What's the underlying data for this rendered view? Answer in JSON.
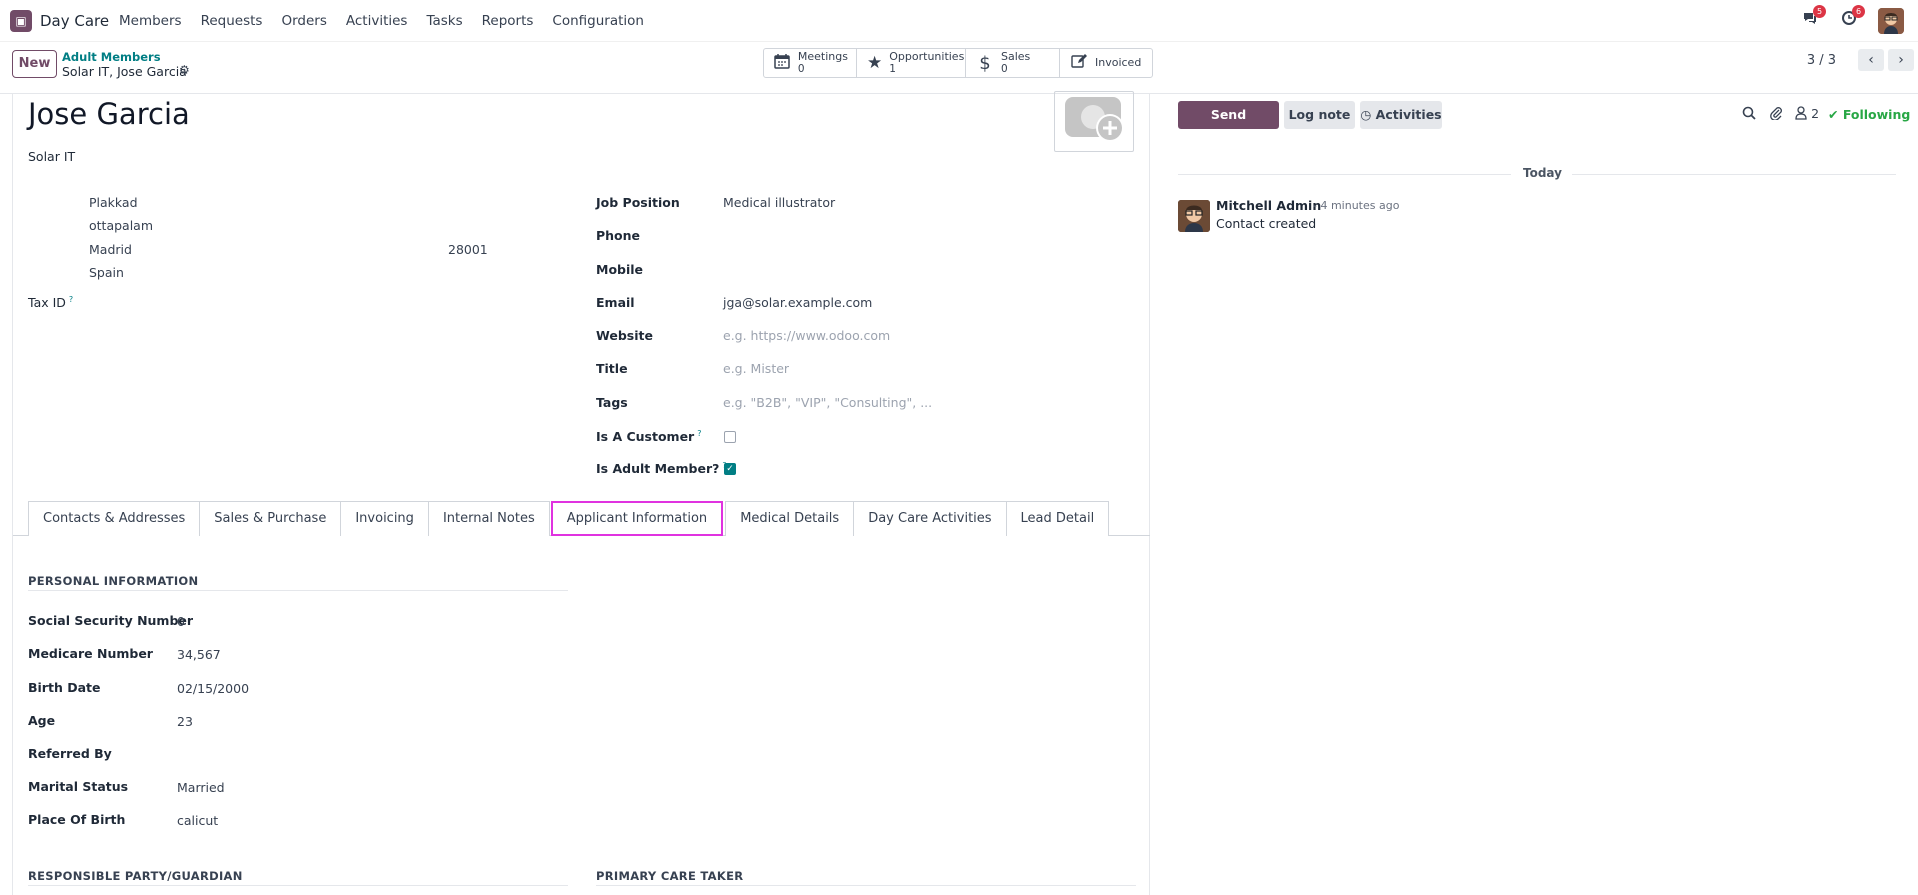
{
  "navbar": {
    "app_name": "Day Care",
    "menu": [
      "Members",
      "Requests",
      "Orders",
      "Activities",
      "Tasks",
      "Reports",
      "Configuration"
    ],
    "messages_badge": "5",
    "activities_badge": "6"
  },
  "control": {
    "new_label": "New",
    "breadcrumb_parent": "Adult Members",
    "breadcrumb_current": "Solar IT, Jose Garcia",
    "smart_buttons": [
      {
        "label": "Meetings",
        "value": "0",
        "icon": "calendar-icon"
      },
      {
        "label": "Opportunities",
        "value": "1",
        "icon": "star-icon"
      },
      {
        "label": "Sales",
        "value": "0",
        "icon": "dollar-icon"
      },
      {
        "label": "Invoiced",
        "value": "",
        "icon": "edit-icon"
      }
    ],
    "pager": "3 / 3"
  },
  "record": {
    "name": "Jose Garcia",
    "company": "Solar IT",
    "address": {
      "street": "Plakkad",
      "street2": "ottapalam",
      "city": "Madrid",
      "zip": "28001",
      "country": "Spain"
    },
    "tax_id_label": "Tax ID",
    "fields": {
      "job_position": {
        "label": "Job Position",
        "value": "Medical illustrator"
      },
      "phone": {
        "label": "Phone",
        "value": ""
      },
      "mobile": {
        "label": "Mobile",
        "value": ""
      },
      "email": {
        "label": "Email",
        "value": "jga@solar.example.com"
      },
      "website": {
        "label": "Website",
        "placeholder": "e.g. https://www.odoo.com"
      },
      "title": {
        "label": "Title",
        "placeholder": "e.g. Mister"
      },
      "tags": {
        "label": "Tags",
        "placeholder": "e.g. \"B2B\", \"VIP\", \"Consulting\", ..."
      },
      "is_customer": {
        "label": "Is A Customer",
        "checked": false
      },
      "is_adult_member": {
        "label": "Is Adult Member?",
        "checked": true
      }
    },
    "help_mark": "?"
  },
  "tabs": [
    "Contacts & Addresses",
    "Sales & Purchase",
    "Invoicing",
    "Internal Notes",
    "Applicant Information",
    "Medical Details",
    "Day Care Activities",
    "Lead Detail"
  ],
  "active_tab": "Applicant Information",
  "applicant": {
    "section_title": "PERSONAL INFORMATION",
    "rows": [
      {
        "label": "Social Security Number",
        "value": "0"
      },
      {
        "label": "Medicare Number",
        "value": "34,567"
      },
      {
        "label": "Birth Date",
        "value": "02/15/2000"
      },
      {
        "label": "Age",
        "value": "23"
      },
      {
        "label": "Referred By",
        "value": ""
      },
      {
        "label": "Marital Status",
        "value": "Married"
      },
      {
        "label": "Place Of Birth",
        "value": "calicut"
      }
    ],
    "guardian_title": "RESPONSIBLE PARTY/GUARDIAN",
    "caretaker_title": "PRIMARY CARE TAKER"
  },
  "chatter": {
    "send_message": "Send message",
    "log_note": "Log note",
    "activities": "Activities",
    "followers_count": "2",
    "following": "Following",
    "today": "Today",
    "message": {
      "author": "Mitchell Admin",
      "time": "- 4 minutes ago",
      "body": "Contact created"
    }
  },
  "colors": {
    "brand": "#714b67",
    "link": "#017e84",
    "success": "#28a745",
    "tab_highlight": "#e032e0"
  }
}
